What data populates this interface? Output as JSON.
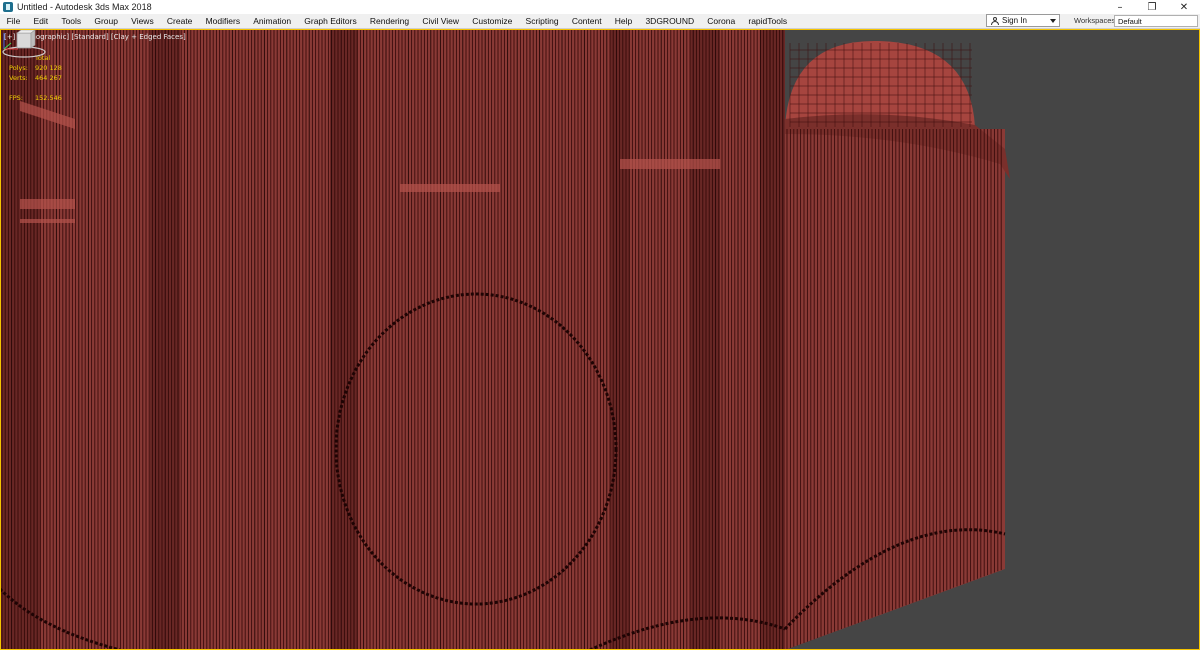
{
  "window": {
    "title": "Untitled - Autodesk 3ds Max 2018",
    "controls": {
      "minimize": "–",
      "restore": "❐",
      "close": "✕"
    }
  },
  "menu": {
    "items": [
      "File",
      "Edit",
      "Tools",
      "Group",
      "Views",
      "Create",
      "Modifiers",
      "Animation",
      "Graph Editors",
      "Rendering",
      "Civil View",
      "Customize",
      "Scripting",
      "Content",
      "Help",
      "3DGROUND",
      "Corona",
      "rapidTools"
    ],
    "sign_in": "Sign In",
    "workspaces_label": "Workspaces:",
    "workspace_value": "Default"
  },
  "viewport": {
    "label": "[+] [Orthographic] [Standard] [Clay + Edged Faces]",
    "stats": {
      "header": "Total",
      "polys_label": "Polys:",
      "polys_value": "920 128",
      "verts_label": "Verts:",
      "verts_value": "464 267",
      "fps_label": "FPS:",
      "fps_value": "152.546"
    },
    "colors": {
      "background": "#454545",
      "mesh_fill": "#8a3a36",
      "mesh_edges": "#3a0c0c",
      "frame": "#f5c400",
      "stats_text": "#f0d200"
    }
  },
  "icons": {
    "app": "3dsmax-app-icon",
    "user": "user-icon",
    "dropdown": "chevron-down-icon",
    "viewcube": "viewcube-icon",
    "axis": "axis-tripod-icon"
  }
}
